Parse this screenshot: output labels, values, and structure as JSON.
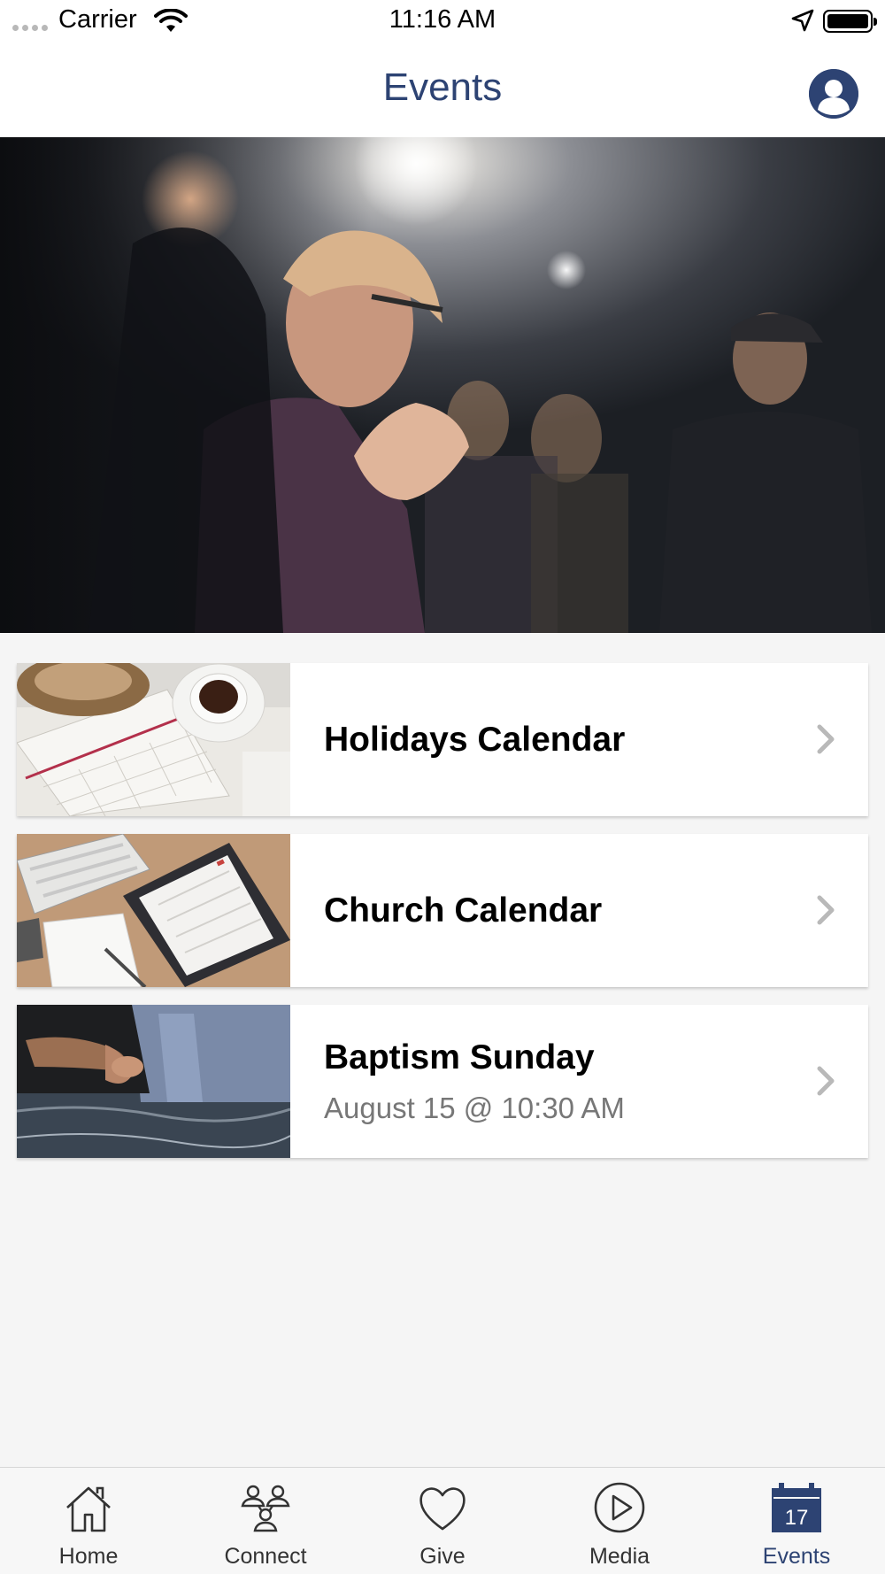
{
  "status_bar": {
    "carrier": "Carrier",
    "time": "11:16 AM"
  },
  "nav": {
    "title": "Events",
    "profile_icon": "person-circle-icon"
  },
  "colors": {
    "accent": "#2d4373",
    "background": "#f5f5f5",
    "card": "#ffffff",
    "subtitle": "#777777"
  },
  "events": [
    {
      "title": "Holidays Calendar",
      "subtitle": "",
      "thumbnail": "planner-and-coffee-photo"
    },
    {
      "title": "Church Calendar",
      "subtitle": "",
      "thumbnail": "tablet-calendar-photo"
    },
    {
      "title": "Baptism Sunday",
      "subtitle": "August 15 @ 10:30 AM",
      "thumbnail": "baptism-photo"
    }
  ],
  "tabs": [
    {
      "label": "Home",
      "icon": "house-icon",
      "active": false
    },
    {
      "label": "Connect",
      "icon": "people-icon",
      "active": false
    },
    {
      "label": "Give",
      "icon": "heart-icon",
      "active": false
    },
    {
      "label": "Media",
      "icon": "play-circle-icon",
      "active": false
    },
    {
      "label": "Events",
      "icon": "calendar-icon",
      "active": true,
      "badge": "17"
    }
  ]
}
